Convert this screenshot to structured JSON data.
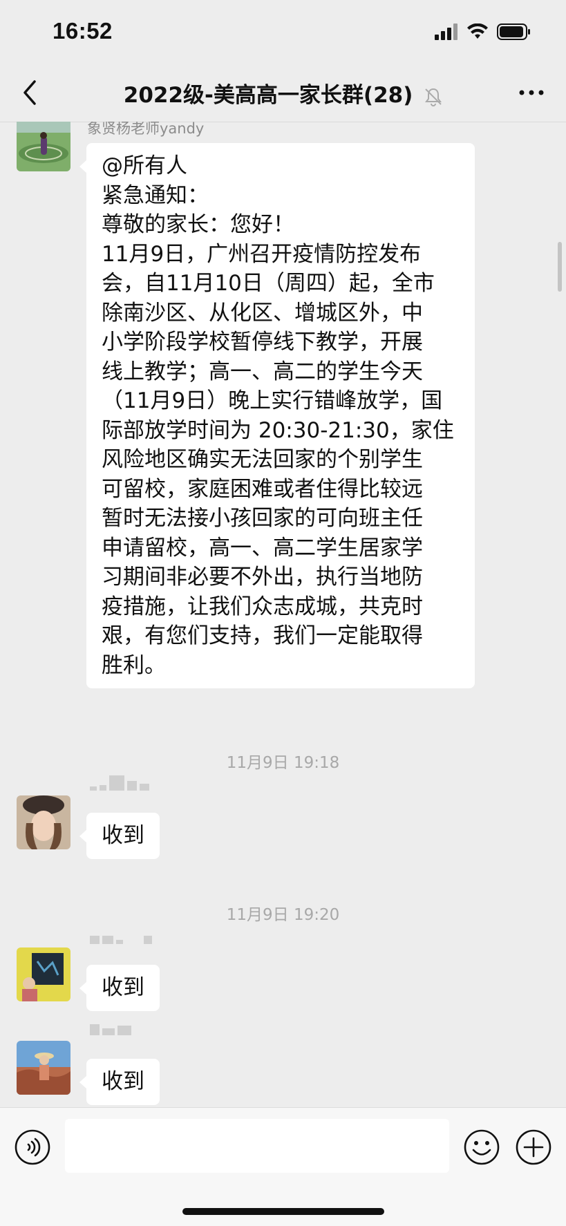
{
  "status_bar": {
    "time": "16:52"
  },
  "nav": {
    "title": "2022级-美高高一家长群(28)",
    "back_icon": "chevron-left-icon",
    "more_icon": "more-dots-icon",
    "mute_icon": "muted-bell-icon"
  },
  "messages": [
    {
      "sender": "象贤杨老师yandy",
      "lines": [
        "@所有人",
        "紧急通知：",
        "尊敬的家长：您好！",
        "11月9日，广州召开疫情防控发布",
        "会，自11月10日（周四）起，全市",
        "除南沙区、从化区、增城区外，中",
        "小学阶段学校暂停线下教学，开展",
        "线上教学；高一、高二的学生今天",
        "（11月9日）晚上实行错峰放学，国",
        "际部放学时间为 20:30-21:30，家住",
        "风险地区确实无法回家的个别学生",
        "可留校，家庭困难或者住得比较远",
        "暂时无法接小孩回家的可向班主任",
        "申请留校，高一、高二学生居家学",
        "习期间非必要不外出，执行当地防",
        "疫措施，让我们众志成城，共克时",
        "艰，有您们支持，我们一定能取得",
        "胜利。"
      ]
    },
    {
      "timestamp": "11月9日 19:18"
    },
    {
      "text": "收到"
    },
    {
      "timestamp": "11月9日 19:20"
    },
    {
      "text": "收到"
    },
    {
      "text": "收到"
    }
  ],
  "input_bar": {
    "voice_icon": "voice-icon",
    "emoji_icon": "emoji-icon",
    "plus_icon": "plus-icon"
  }
}
